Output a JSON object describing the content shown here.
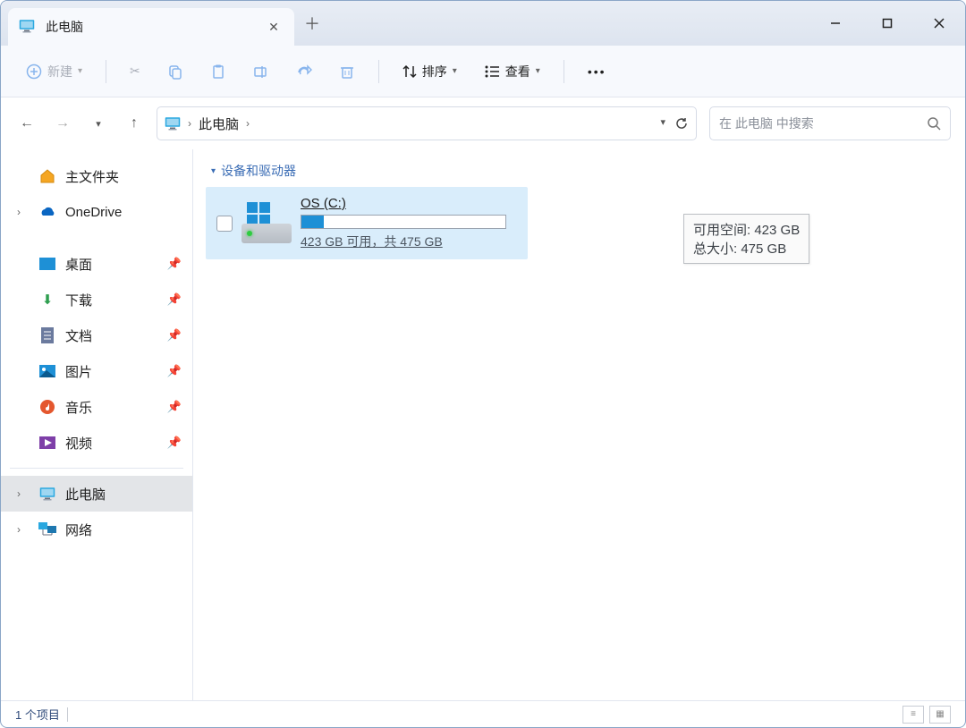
{
  "tab": {
    "title": "此电脑"
  },
  "toolbar": {
    "new": "新建",
    "sort": "排序",
    "view": "查看"
  },
  "breadcrumb": {
    "location": "此电脑"
  },
  "search": {
    "placeholder": "在 此电脑 中搜索"
  },
  "sidebar": {
    "home": "主文件夹",
    "onedrive": "OneDrive",
    "pinned": {
      "desktop": "桌面",
      "downloads": "下载",
      "documents": "文档",
      "pictures": "图片",
      "music": "音乐",
      "videos": "视频"
    },
    "thispc": "此电脑",
    "network": "网络"
  },
  "group": {
    "header": "设备和驱动器"
  },
  "drive": {
    "name": "OS (C:)",
    "sub": "423 GB 可用，共 475 GB",
    "fill_percent": 11
  },
  "tooltip": {
    "l1": "可用空间: 423 GB",
    "l2": "总大小: 475 GB"
  },
  "status": {
    "count": "1 个项目"
  }
}
